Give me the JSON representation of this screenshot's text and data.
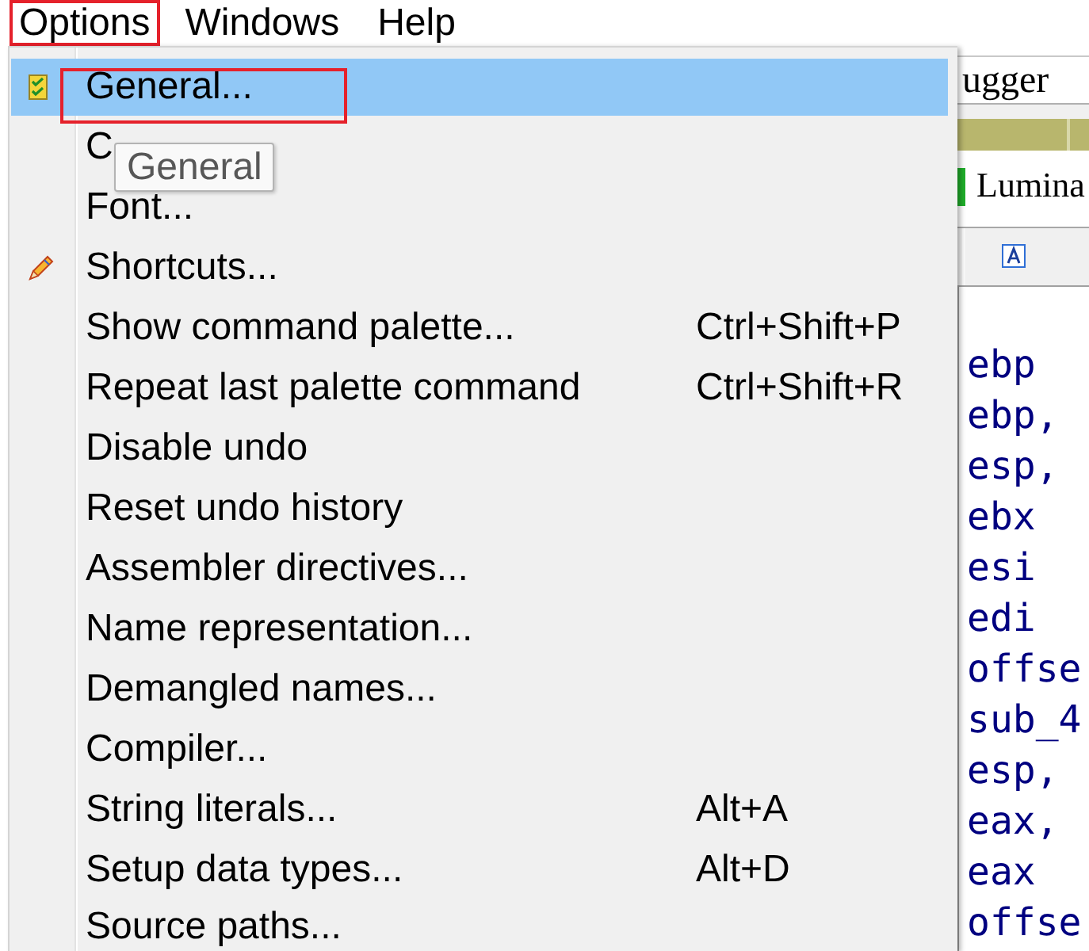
{
  "menu_bar": [
    {
      "label": "Options",
      "marked": true
    },
    {
      "label": "Windows",
      "marked": false
    },
    {
      "label": "Help",
      "marked": false
    }
  ],
  "menu": {
    "items": [
      {
        "label": "General...",
        "kind": "checklist",
        "selected": true,
        "marked": true
      },
      {
        "label": "C",
        "kind": "plain",
        "selected": false,
        "marked": false
      },
      {
        "label": "Font...",
        "kind": "plain",
        "selected": false,
        "marked": false
      },
      {
        "label": "Shortcuts...",
        "kind": "pencil",
        "selected": false,
        "marked": false
      },
      {
        "label": "Show command palette...",
        "shortcut": "Ctrl+Shift+P",
        "kind": "plain",
        "selected": false,
        "marked": false
      },
      {
        "label": "Repeat last palette command",
        "shortcut": "Ctrl+Shift+R",
        "kind": "plain",
        "selected": false,
        "marked": false
      },
      {
        "label": "Disable undo",
        "kind": "plain",
        "selected": false,
        "marked": false
      },
      {
        "label": "Reset undo history",
        "kind": "plain",
        "selected": false,
        "marked": false
      },
      {
        "label": "Assembler directives...",
        "kind": "plain",
        "selected": false,
        "marked": false
      },
      {
        "label": "Name representation...",
        "kind": "plain",
        "selected": false,
        "marked": false
      },
      {
        "label": "Demangled names...",
        "kind": "plain",
        "selected": false,
        "marked": false
      },
      {
        "label": "Compiler...",
        "kind": "plain",
        "selected": false,
        "marked": false
      },
      {
        "label": "String literals...",
        "shortcut": "Alt+A",
        "kind": "plain",
        "selected": false,
        "marked": false
      },
      {
        "label": "Setup data types...",
        "shortcut": "Alt+D",
        "kind": "plain",
        "selected": false,
        "marked": false
      },
      {
        "label": "Source paths...",
        "kind": "plain",
        "selected": false,
        "marked": false
      }
    ],
    "tooltip": "General"
  },
  "background_window": {
    "tab": "ugger",
    "header": "Lumina",
    "code_lines": [
      "ebp",
      "ebp,",
      "esp,",
      "ebx",
      "esi",
      "edi",
      "offse",
      "sub_4",
      "esp,",
      "eax,",
      "eax",
      "offse"
    ]
  }
}
